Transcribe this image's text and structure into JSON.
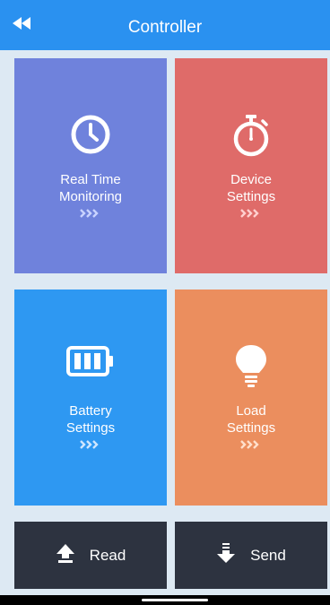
{
  "header": {
    "title": "Controller",
    "back_icon": "double-chevron-left-icon",
    "background": "#2a91f0"
  },
  "tiles": [
    {
      "line1": "Real Time",
      "line2": "Monitoring",
      "icon": "clock-icon",
      "color": "#6f82dc"
    },
    {
      "line1": "Device",
      "line2": "Settings",
      "icon": "stopwatch-icon",
      "color": "#df6b69"
    },
    {
      "line1": "Battery",
      "line2": "Settings",
      "icon": "battery-icon",
      "color": "#2e98f2"
    },
    {
      "line1": "Load",
      "line2": "Settings",
      "icon": "lightbulb-icon",
      "color": "#eb8e5e"
    }
  ],
  "actions": {
    "read_label": "Read",
    "read_icon": "upload-arrow-icon",
    "send_label": "Send",
    "send_icon": "download-arrow-icon",
    "background": "#2d3340"
  },
  "page_background": "#dde9f3"
}
